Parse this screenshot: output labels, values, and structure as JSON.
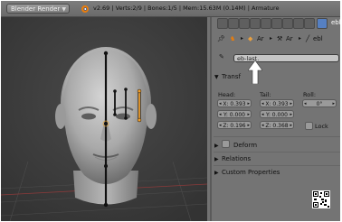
{
  "header": {
    "render_engine": "Blender Render",
    "stats": "v2.69 | Verts:2/9 | Bones:1/5 | Mem:15.63M (0.14M) | Armature"
  },
  "properties": {
    "active_tab_label": "ebl",
    "breadcrumb": {
      "object": "Ar",
      "armature": "Ar",
      "bone": "ebl"
    },
    "bone_name": "eb-last.",
    "transform": {
      "title": "Transf",
      "head_label": "Head:",
      "tail_label": "Tail:",
      "roll_label": "Roll:",
      "head": [
        "X: 0.393",
        "Y: 0.000",
        "Z: 0.196"
      ],
      "tail": [
        "X: 0.393",
        "Y: 0.000",
        "Z: 0.368"
      ],
      "roll": "0°",
      "lock_label": "Lock"
    },
    "sections": {
      "deform": "Deform",
      "relations": "Relations",
      "custom_properties": "Custom Properties"
    }
  },
  "colors": {
    "selected_bone": "#f0a030",
    "active_tab": "#5680c2",
    "viewport_bg": "#3a3a3a"
  }
}
